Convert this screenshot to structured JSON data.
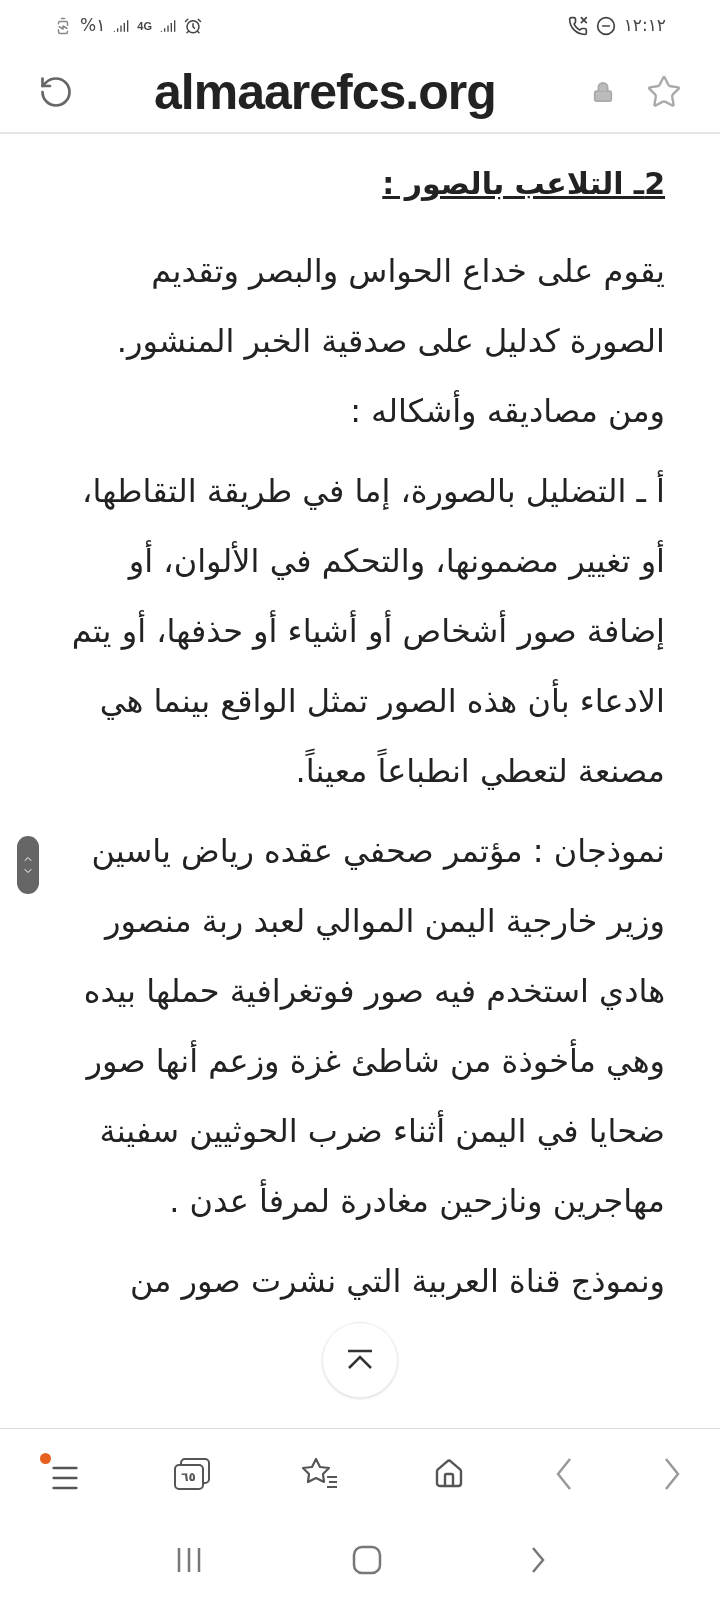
{
  "status_bar": {
    "time": "١٢:١٢",
    "battery": "%١",
    "network": "4G"
  },
  "address_bar": {
    "domain": "almaarefcs.org"
  },
  "article": {
    "heading": "2ـ التلاعب بالصور :",
    "paragraphs": [
      "يقوم على خداع الحواس والبصر وتقديم الصورة كدليل على صدقية الخبر المنشور. ومن مصاديقه وأشكاله :",
      "أ ـ التضليل بالصورة، إما في طريقة التقاطها، أو تغيير مضمونها، والتحكم في الألوان، أو إضافة صور أشخاص أو أشياء أو حذفها، أو يتم الادعاء بأن هذه الصور تمثل الواقع بينما هي مصنعة لتعطي انطباعاً معيناً.",
      "نموذجان : مؤتمر صحفي عقده رياض ياسين وزير خارجية اليمن الموالي لعبد ربة منصور هادي استخدم فيه صور فوتغرافية حملها بيده وهي مأخوذة من شاطئ غزة وزعم أنها صور ضحايا في اليمن أثناء ضرب الحوثيين سفينة مهاجرين ونازحين مغادرة لمرفأ عدن .",
      "ونموذج قناة العربية التي نشرت صور من"
    ]
  },
  "toolbar": {
    "tabs_count": "٦٥",
    "menu_notification": true
  }
}
